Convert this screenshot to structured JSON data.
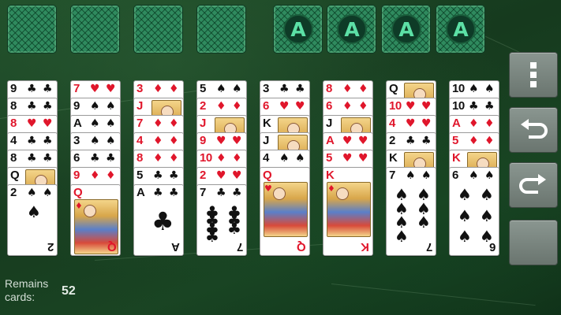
{
  "foundations": [
    {
      "label": ""
    },
    {
      "label": ""
    },
    {
      "label": ""
    },
    {
      "label": ""
    },
    {
      "label": "A"
    },
    {
      "label": "A"
    },
    {
      "label": "A"
    },
    {
      "label": "A"
    }
  ],
  "tableau": [
    [
      {
        "rank": "9",
        "suit": "♣",
        "color": "black"
      },
      {
        "rank": "8",
        "suit": "♣",
        "color": "black"
      },
      {
        "rank": "8",
        "suit": "♥",
        "color": "red"
      },
      {
        "rank": "4",
        "suit": "♣",
        "color": "black"
      },
      {
        "rank": "8",
        "suit": "♣",
        "color": "black"
      },
      {
        "rank": "Q",
        "suit": "♠",
        "color": "black",
        "face": true
      },
      {
        "rank": "2",
        "suit": "♠",
        "color": "black",
        "last": true
      }
    ],
    [
      {
        "rank": "7",
        "suit": "♥",
        "color": "red"
      },
      {
        "rank": "9",
        "suit": "♠",
        "color": "black"
      },
      {
        "rank": "A",
        "suit": "♠",
        "color": "black"
      },
      {
        "rank": "3",
        "suit": "♠",
        "color": "black"
      },
      {
        "rank": "6",
        "suit": "♣",
        "color": "black"
      },
      {
        "rank": "9",
        "suit": "♦",
        "color": "red"
      },
      {
        "rank": "Q",
        "suit": "♦",
        "color": "red",
        "last": true,
        "face": true
      }
    ],
    [
      {
        "rank": "3",
        "suit": "♦",
        "color": "red"
      },
      {
        "rank": "J",
        "suit": "♦",
        "color": "red",
        "face": true
      },
      {
        "rank": "7",
        "suit": "♦",
        "color": "red"
      },
      {
        "rank": "4",
        "suit": "♦",
        "color": "red"
      },
      {
        "rank": "8",
        "suit": "♦",
        "color": "red"
      },
      {
        "rank": "5",
        "suit": "♣",
        "color": "black"
      },
      {
        "rank": "A",
        "suit": "♣",
        "color": "black",
        "last": true
      }
    ],
    [
      {
        "rank": "5",
        "suit": "♠",
        "color": "black"
      },
      {
        "rank": "2",
        "suit": "♦",
        "color": "red"
      },
      {
        "rank": "J",
        "suit": "♦",
        "color": "red",
        "face": true
      },
      {
        "rank": "9",
        "suit": "♥",
        "color": "red"
      },
      {
        "rank": "10",
        "suit": "♦",
        "color": "red"
      },
      {
        "rank": "2",
        "suit": "♥",
        "color": "red"
      },
      {
        "rank": "7",
        "suit": "♣",
        "color": "black",
        "last": true
      }
    ],
    [
      {
        "rank": "3",
        "suit": "♣",
        "color": "black"
      },
      {
        "rank": "6",
        "suit": "♥",
        "color": "red"
      },
      {
        "rank": "K",
        "suit": "♣",
        "color": "black",
        "face": true
      },
      {
        "rank": "J",
        "suit": "♣",
        "color": "black",
        "face": true
      },
      {
        "rank": "4",
        "suit": "♠",
        "color": "black"
      },
      {
        "rank": "Q",
        "suit": "♥",
        "color": "red",
        "last": true,
        "face": true
      }
    ],
    [
      {
        "rank": "8",
        "suit": "♦",
        "color": "red"
      },
      {
        "rank": "6",
        "suit": "♦",
        "color": "red"
      },
      {
        "rank": "J",
        "suit": "♠",
        "color": "black",
        "face": true
      },
      {
        "rank": "A",
        "suit": "♥",
        "color": "red"
      },
      {
        "rank": "5",
        "suit": "♥",
        "color": "red"
      },
      {
        "rank": "K",
        "suit": "♦",
        "color": "red",
        "last": true,
        "face": true
      }
    ],
    [
      {
        "rank": "Q",
        "suit": "♣",
        "color": "black",
        "face": true
      },
      {
        "rank": "10",
        "suit": "♥",
        "color": "red"
      },
      {
        "rank": "4",
        "suit": "♥",
        "color": "red"
      },
      {
        "rank": "2",
        "suit": "♣",
        "color": "black"
      },
      {
        "rank": "K",
        "suit": "♠",
        "color": "black",
        "face": true
      },
      {
        "rank": "7",
        "suit": "♠",
        "color": "black",
        "last": true
      }
    ],
    [
      {
        "rank": "10",
        "suit": "♠",
        "color": "black"
      },
      {
        "rank": "10",
        "suit": "♣",
        "color": "black"
      },
      {
        "rank": "A",
        "suit": "♦",
        "color": "red"
      },
      {
        "rank": "5",
        "suit": "♦",
        "color": "red"
      },
      {
        "rank": "K",
        "suit": "♥",
        "color": "red",
        "face": true
      },
      {
        "rank": "6",
        "suit": "♠",
        "color": "black",
        "last": true
      }
    ]
  ],
  "menu_buttons": [
    {
      "icon": "more-vertical-icon"
    },
    {
      "icon": "undo-icon"
    },
    {
      "icon": "redo-icon"
    },
    {
      "icon": "blank"
    }
  ],
  "status": {
    "remains_label": "Remains cards:",
    "remains_count": "52"
  },
  "colors": {
    "felt": "#1d4a27",
    "card_back": "#2f8a5e",
    "ace_text": "#5ce0a6",
    "red_suit": "#e0162b"
  }
}
